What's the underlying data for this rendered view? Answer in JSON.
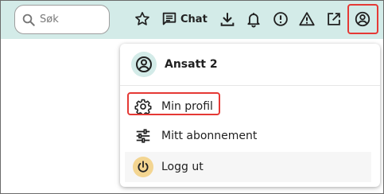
{
  "search": {
    "placeholder": "Søk"
  },
  "toolbar": {
    "chat_label": "Chat",
    "icons": [
      "star-icon",
      "chat-icon",
      "download-icon",
      "bell-icon",
      "alert-circle-icon",
      "warning-triangle-icon",
      "open-external-icon",
      "account-circle-icon"
    ]
  },
  "menu": {
    "user_name": "Ansatt 2",
    "items": [
      {
        "label": "Min profil",
        "icon": "gear-icon"
      },
      {
        "label": "Mitt abonnement",
        "icon": "sliders-icon"
      },
      {
        "label": "Logg ut",
        "icon": "power-icon"
      }
    ]
  },
  "colors": {
    "topbar": "#d3ebe8",
    "highlight": "#e53935",
    "logout_icon_bg": "#f3d591",
    "avatar_bg": "#d3ebe8"
  }
}
